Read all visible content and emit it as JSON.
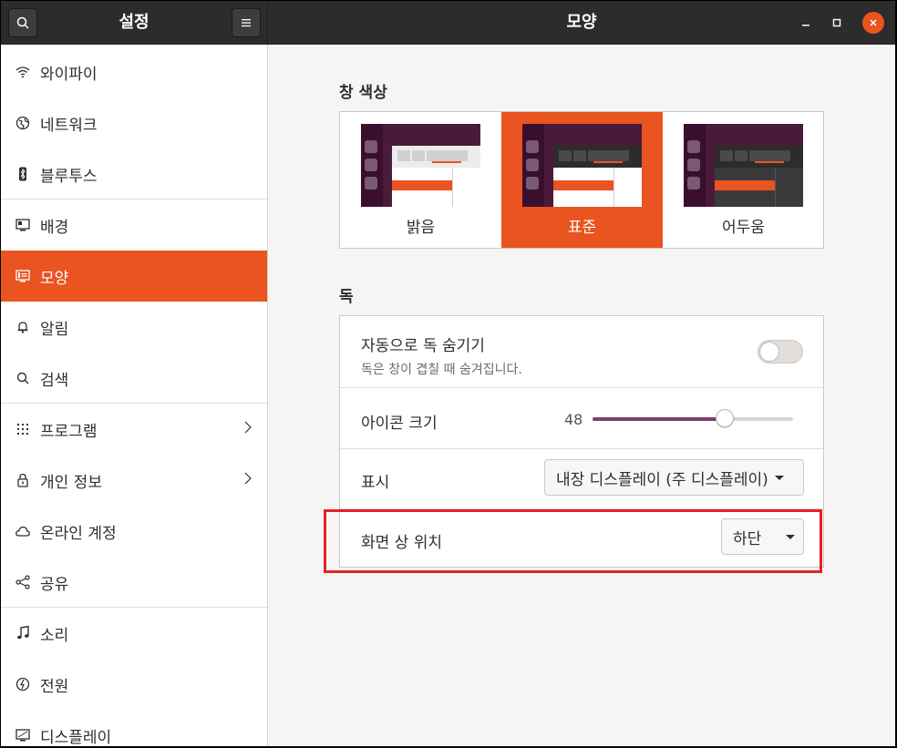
{
  "header": {
    "sidebar_title": "설정",
    "page_title": "모양"
  },
  "sidebar": {
    "items": [
      {
        "label": "와이파이",
        "icon": "wifi-icon"
      },
      {
        "label": "네트워크",
        "icon": "network-icon"
      },
      {
        "label": "블루투스",
        "icon": "bluetooth-icon"
      },
      {
        "label": "배경",
        "icon": "background-icon"
      },
      {
        "label": "모양",
        "icon": "appearance-icon",
        "active": true
      },
      {
        "label": "알림",
        "icon": "bell-icon"
      },
      {
        "label": "검색",
        "icon": "search-icon"
      },
      {
        "label": "프로그램",
        "icon": "apps-grid-icon"
      },
      {
        "label": "개인 정보",
        "icon": "lock-icon"
      },
      {
        "label": "온라인 계정",
        "icon": "cloud-icon"
      },
      {
        "label": "공유",
        "icon": "share-icon"
      },
      {
        "label": "소리",
        "icon": "music-note-icon"
      },
      {
        "label": "전원",
        "icon": "power-icon"
      },
      {
        "label": "디스플레이",
        "icon": "display-icon"
      }
    ]
  },
  "window_colors": {
    "title": "창 색상",
    "options": [
      {
        "label": "밝음"
      },
      {
        "label": "표준",
        "selected": true
      },
      {
        "label": "어두움"
      }
    ]
  },
  "dock": {
    "title": "독",
    "auto_hide": {
      "label": "자동으로 독 숨기기",
      "description": "독은 창이 겹칠 때 숨겨집니다.",
      "enabled": false
    },
    "icon_size": {
      "label": "아이콘 크기",
      "value": "48",
      "fraction": 0.66
    },
    "show_on": {
      "label": "표시",
      "value": "내장 디스플레이 (주 디스플레이)"
    },
    "position": {
      "label": "화면 상 위치",
      "value": "하단"
    }
  },
  "colors": {
    "accent": "#e95420",
    "highlight": "#e3222a",
    "slider": "#7c3d72",
    "header": "#2c2c2c"
  }
}
